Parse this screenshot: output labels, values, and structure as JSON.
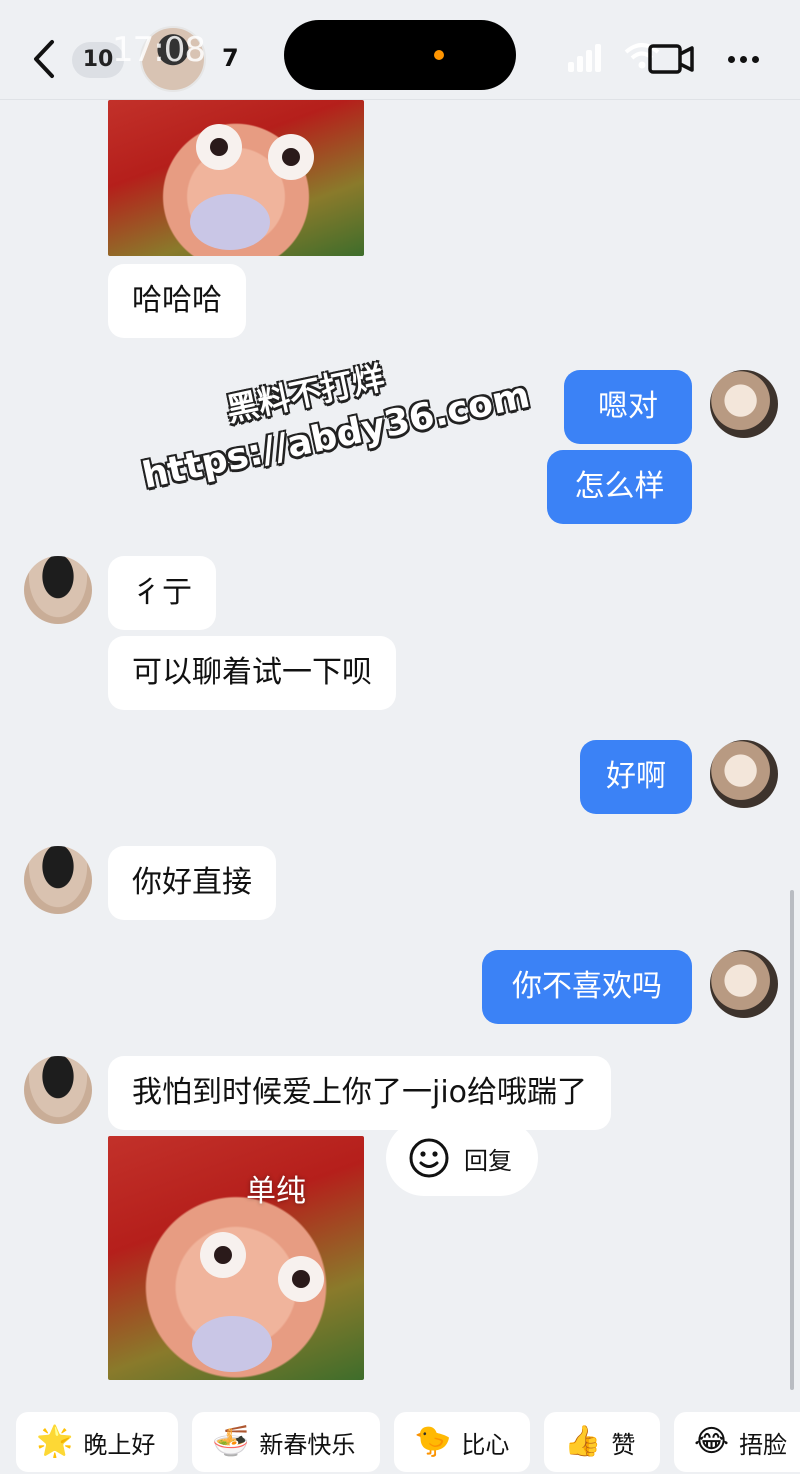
{
  "header": {
    "unread_count": "10",
    "status_time": "17:08",
    "contact_name": "7"
  },
  "messages": {
    "m1": "哈哈哈",
    "m2": "嗯对",
    "m3": "怎么样",
    "m4": "彳亍",
    "m5": "可以聊着试一下呗",
    "m6": "好啊",
    "m7": "你好直接",
    "m8": "你不喜欢吗",
    "m9": "我怕到时候爱上你了一jio给哦踹了"
  },
  "sticker_caption": "单纯",
  "reply_label": "回复",
  "watermark": {
    "line1": "黑料不打烊",
    "line2": "https://abdy36.com"
  },
  "quick_replies": [
    {
      "emoji": "🌟",
      "label": "晚上好"
    },
    {
      "emoji": "🍜",
      "label": "新春快乐"
    },
    {
      "emoji": "🐤",
      "label": "比心"
    },
    {
      "emoji": "👍",
      "label": "赞"
    },
    {
      "emoji": "😂",
      "label": "捂脸"
    }
  ],
  "colors": {
    "outgoing_bubble": "#3b82f6",
    "incoming_bubble": "#ffffff",
    "background": "#eef0f3"
  }
}
